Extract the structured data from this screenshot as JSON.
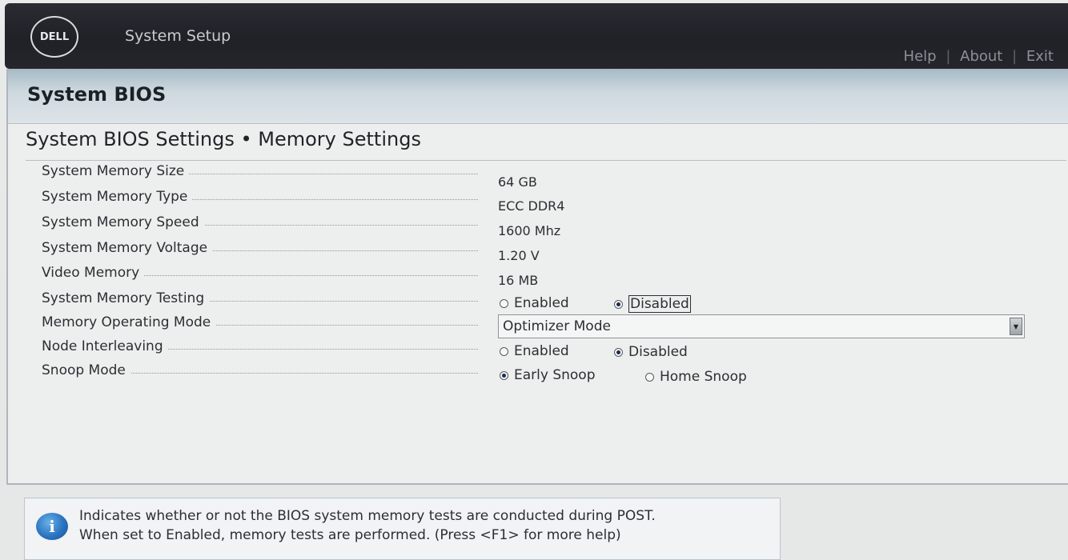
{
  "header": {
    "logo_text": "DELL",
    "app_title": "System Setup",
    "links": [
      "Help",
      "About",
      "Exit"
    ],
    "link_separator": "|"
  },
  "panel": {
    "title": "System BIOS",
    "section_title": "System BIOS Settings • Memory Settings"
  },
  "settings": {
    "memory_size": {
      "label": "System Memory Size",
      "value": "64 GB"
    },
    "memory_type": {
      "label": "System Memory Type",
      "value": "ECC DDR4"
    },
    "memory_speed": {
      "label": "System Memory Speed",
      "value": "1600 Mhz"
    },
    "memory_voltage": {
      "label": "System Memory Voltage",
      "value": "1.20 V"
    },
    "video_memory": {
      "label": "Video Memory",
      "value": "16 MB"
    },
    "memory_testing": {
      "label": "System Memory Testing",
      "options": [
        "Enabled",
        "Disabled"
      ],
      "selected": "Disabled"
    },
    "operating_mode": {
      "label": "Memory Operating Mode",
      "value": "Optimizer Mode"
    },
    "node_interleaving": {
      "label": "Node Interleaving",
      "options": [
        "Enabled",
        "Disabled"
      ],
      "selected": "Disabled"
    },
    "snoop_mode": {
      "label": "Snoop Mode",
      "options": [
        "Early Snoop",
        "Home Snoop"
      ],
      "selected": "Early Snoop"
    }
  },
  "help": {
    "icon": "info-icon",
    "icon_glyph": "i",
    "line1": "Indicates whether or not the BIOS system memory tests are conducted during POST.",
    "line2": "When set to Enabled, memory tests are performed. (Press <F1> for more help)"
  },
  "colors": {
    "header_bg": "#23252b",
    "title_bar": "#b9c9d3",
    "radio_dot": "#1b2a55",
    "info_blue": "#2a74c0"
  }
}
